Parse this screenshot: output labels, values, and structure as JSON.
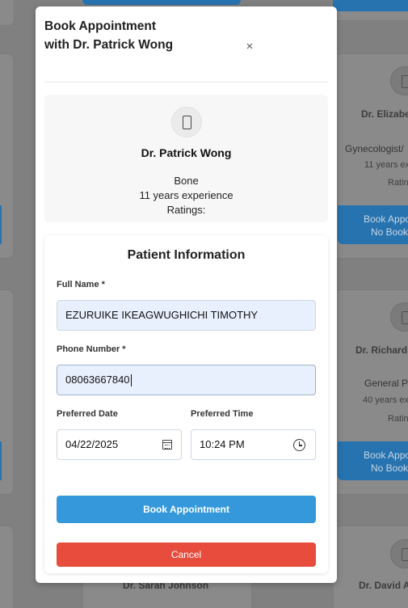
{
  "background": {
    "card_right_1": {
      "name": "Dr. Elizabe",
      "specialty": "Gynecologist/",
      "experience": "11 years ex",
      "ratings": "Ratin",
      "book_label": "Book Appo",
      "sub_label": "No Book"
    },
    "card_right_2": {
      "name": "Dr. Richard",
      "specialty": "General P",
      "experience": "40 years ex",
      "ratings": "Ratin",
      "book_label": "Book Appo",
      "sub_label": "No Book"
    },
    "card_bottom_mid": {
      "name": "Dr. Sarah Johnson"
    },
    "card_bottom_right": {
      "name": "Dr. David A"
    }
  },
  "modal": {
    "title": "Book Appointment with Dr. Patrick Wong",
    "close_glyph": "×",
    "doctor": {
      "avatar_icon": "phone-icon",
      "name": "Dr. Patrick Wong",
      "specialty": "Bone",
      "experience": "11 years experience",
      "ratings": "Ratings:"
    },
    "form": {
      "title": "Patient Information",
      "full_name": {
        "label": "Full Name *",
        "value": "EZURUIKE IKEAGWUGHICHI TIMOTHY"
      },
      "phone": {
        "label": "Phone Number *",
        "value": "08063667840"
      },
      "date": {
        "label": "Preferred Date",
        "value": "04/22/2025",
        "icon": "calendar-icon"
      },
      "time": {
        "label": "Preferred Time",
        "value": "10:24 PM",
        "icon": "clock-icon"
      },
      "submit_label": "Book Appointment",
      "cancel_label": "Cancel"
    }
  },
  "colors": {
    "primary": "#3498db",
    "danger": "#e74c3c",
    "input_filled": "#e8f0fe",
    "overlay_blue": "#2673b0"
  }
}
